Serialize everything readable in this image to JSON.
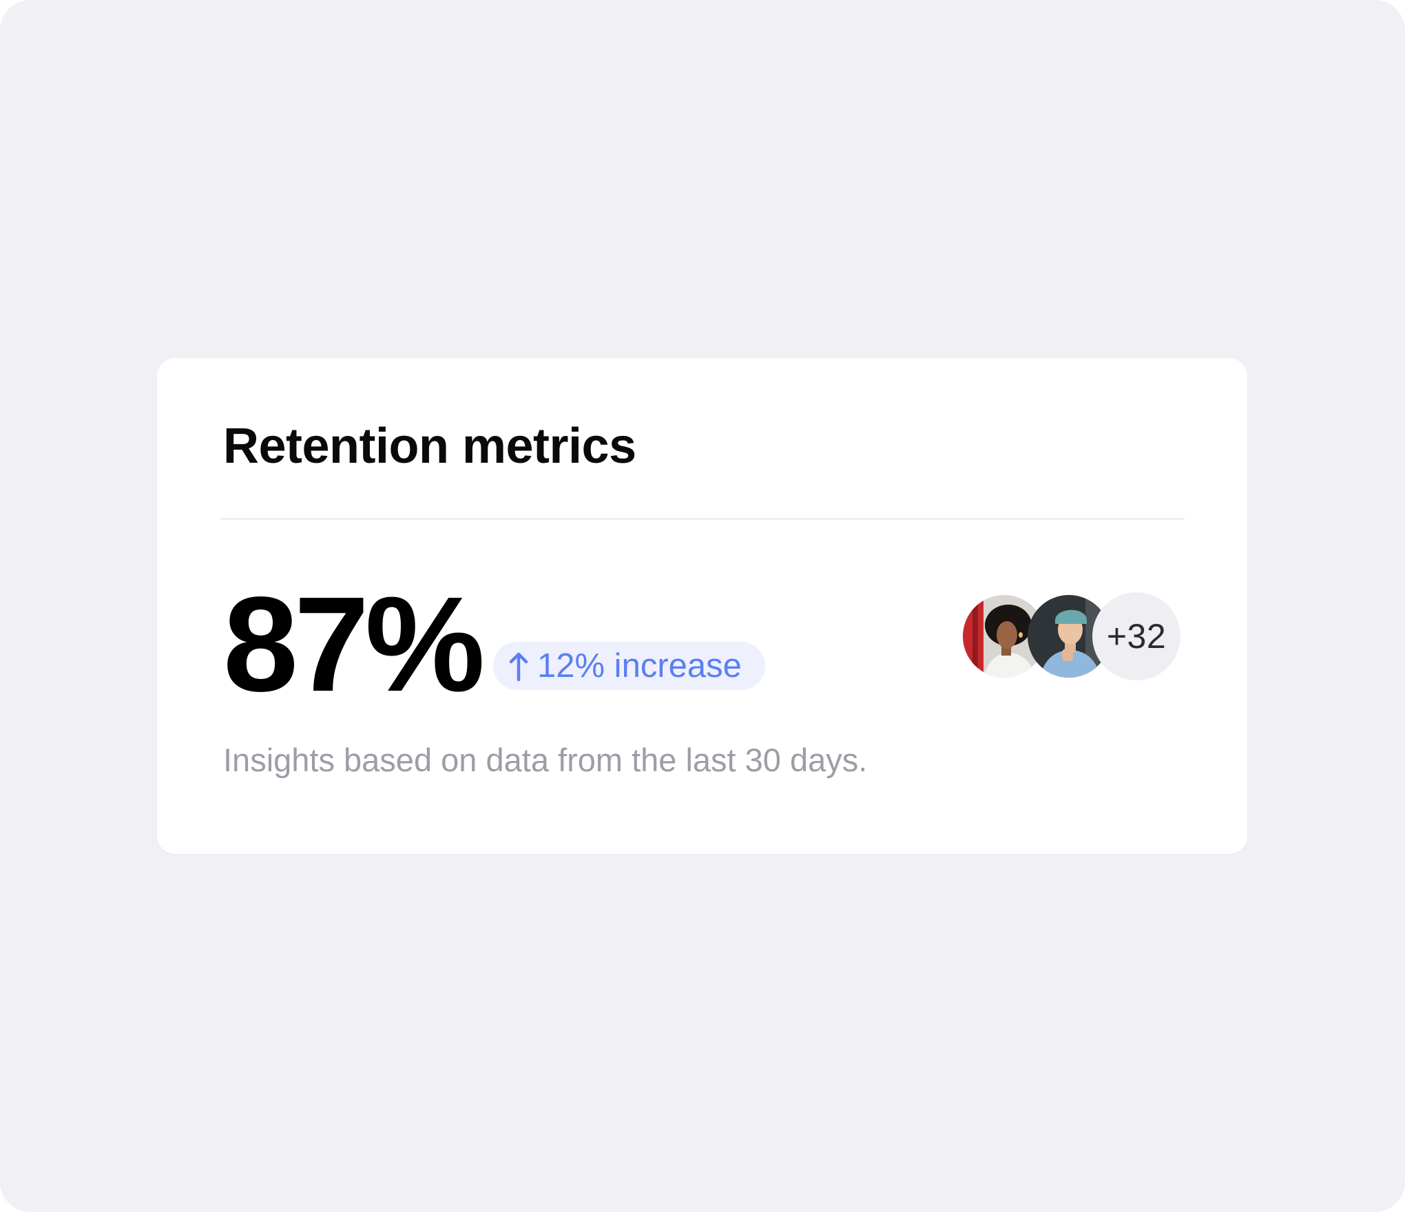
{
  "card": {
    "title": "Retention metrics",
    "metric": {
      "value": "87%",
      "trend": {
        "direction": "up",
        "arrow_icon": "arrow-up-icon",
        "label": "12% increase",
        "color": "#5b7ff0",
        "background": "#eef0fd"
      }
    },
    "avatars": {
      "people": [
        {
          "icon": "person-photo-woman"
        },
        {
          "icon": "person-photo-man"
        }
      ],
      "overflow_label": "+32"
    },
    "footnote": "Insights based on data from the last 30 days."
  },
  "colors": {
    "page_background": "#f0f0f5",
    "card_background": "#ffffff",
    "title_color": "#0a0a0a",
    "muted_text": "#9d9da6"
  }
}
